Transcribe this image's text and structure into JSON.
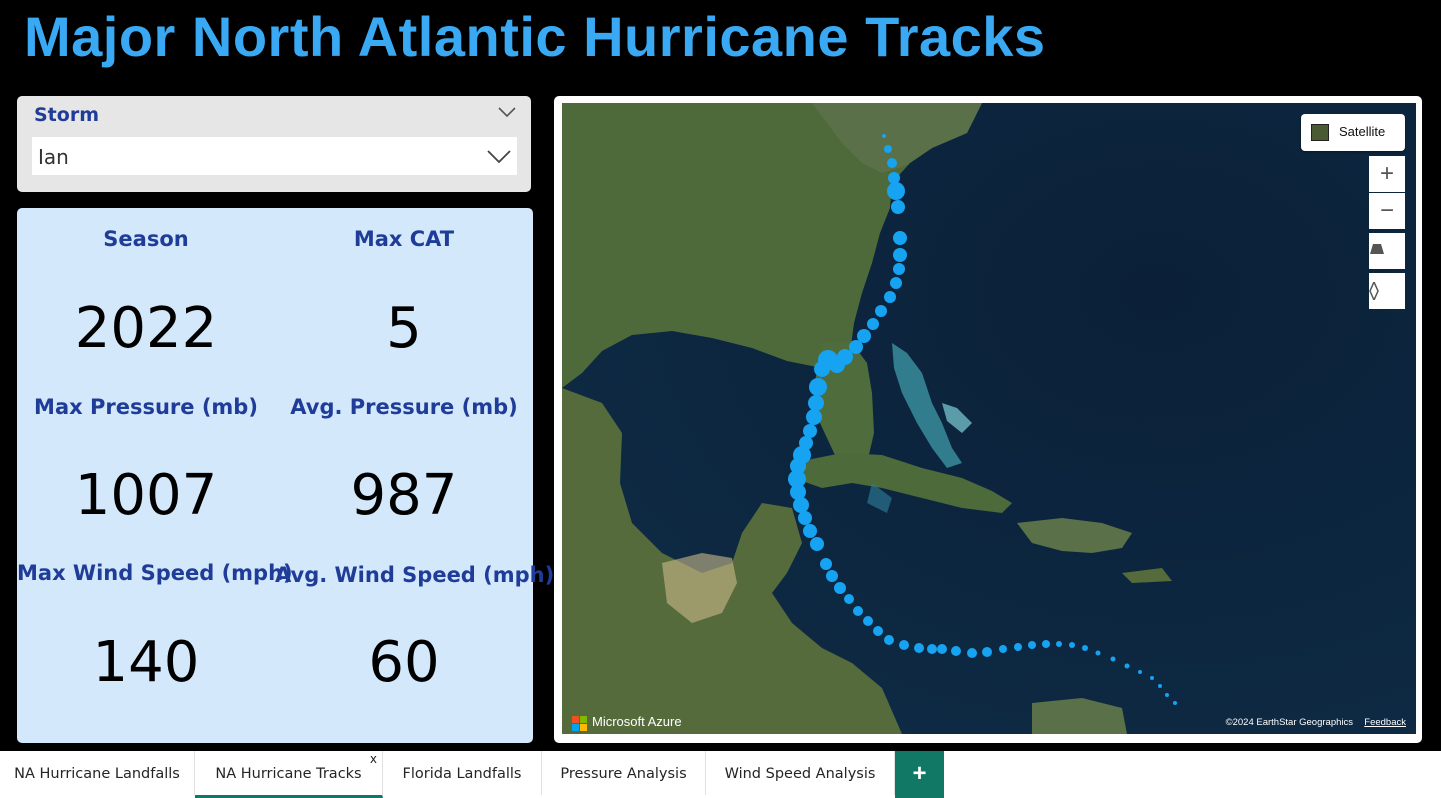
{
  "title": "Major North Atlantic Hurricane Tracks",
  "slicer": {
    "label": "Storm",
    "value": "Ian"
  },
  "kpis": {
    "season": {
      "label": "Season",
      "value": "2022"
    },
    "max_cat": {
      "label": "Max CAT",
      "value": "5"
    },
    "max_pressure": {
      "label": "Max Pressure (mb)",
      "value": "1007"
    },
    "avg_pressure": {
      "label": "Avg. Pressure (mb)",
      "value": "987"
    },
    "max_wind": {
      "label": "Max Wind Speed (mph)",
      "value": "140"
    },
    "avg_wind": {
      "label": "Avg. Wind Speed (mph)",
      "value": "60"
    }
  },
  "map": {
    "style_label": "Satellite",
    "zoom_in": "+",
    "zoom_out": "−",
    "provider": "Microsoft Azure",
    "copyright": "©2024 EarthStar Geographics",
    "feedback": "Feedback",
    "marker_color": "#16a3f2"
  },
  "tabs": [
    {
      "label": "NA Hurricane Landfalls",
      "active": false
    },
    {
      "label": "NA Hurricane Tracks",
      "active": true,
      "close": "x"
    },
    {
      "label": "Florida Landfalls",
      "active": false
    },
    {
      "label": "Pressure Analysis",
      "active": false
    },
    {
      "label": "Wind Speed Analysis",
      "active": false
    }
  ],
  "add_tab_label": "+",
  "colors": {
    "title": "#3aa9f3",
    "label": "#1f3c99",
    "card_bg": "#d3e8fa",
    "accent": "#117865"
  }
}
